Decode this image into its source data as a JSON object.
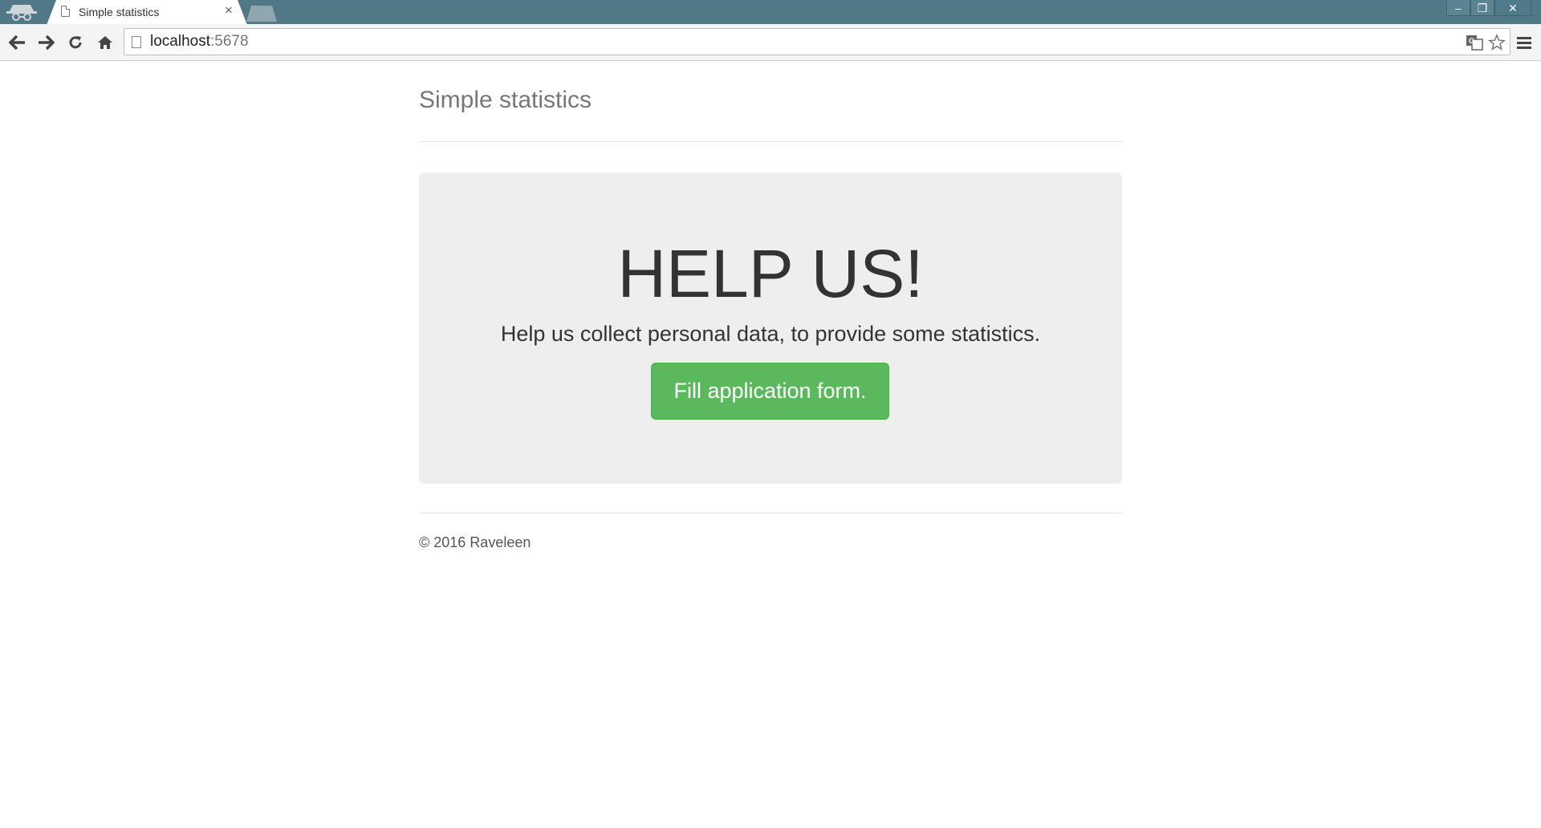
{
  "browser": {
    "tab_title": "Simple statistics",
    "tab_close": "×",
    "url_host": "localhost",
    "url_port": ":5678",
    "window_buttons": {
      "minimize": "–",
      "restore": "❐",
      "close": "✕"
    }
  },
  "header": {
    "brand": "Simple statistics"
  },
  "jumbotron": {
    "heading": "HELP US!",
    "lead": "Help us collect personal data, to provide some statistics.",
    "button_label": "Fill application form."
  },
  "footer": {
    "text": "© 2016 Raveleen"
  },
  "colors": {
    "button": "#5cb85c",
    "jumbotron_bg": "#eeeeee",
    "titlebar": "#507887"
  }
}
